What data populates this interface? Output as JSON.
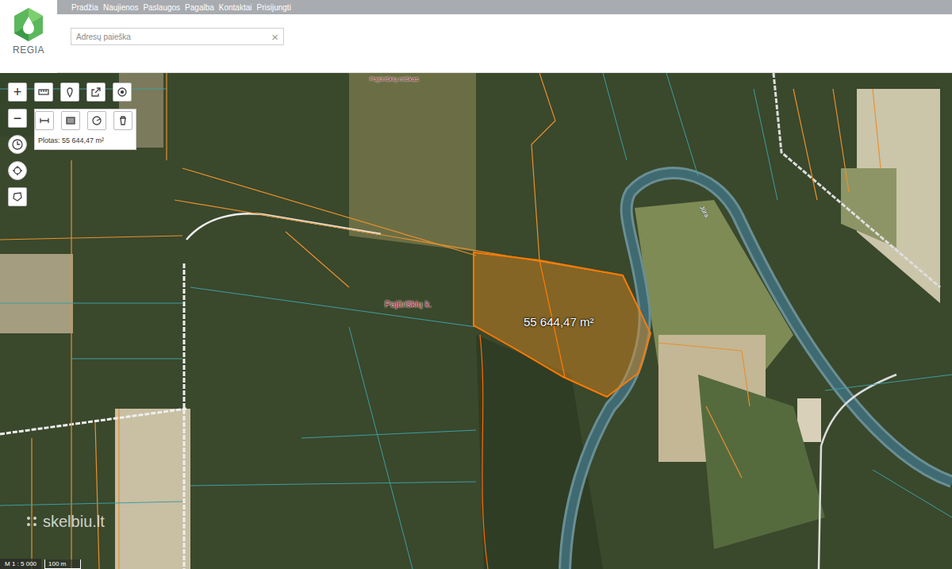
{
  "header": {
    "logo": "REGIA",
    "nav": [
      "Pradžia",
      "Naujienos",
      "Paslaugos",
      "Pagalba",
      "Kontaktai",
      "Prisijungti"
    ],
    "search": {
      "placeholder": "Adresų paieška",
      "clear": "×"
    }
  },
  "map": {
    "tools": {
      "zoom_in": "+",
      "zoom_out": "−"
    },
    "measure": {
      "label": "Plotas: 55 644,47 m²"
    },
    "area_label": "55 644,47 m²",
    "places": [
      {
        "name": "Pajūriškių miškas",
        "kind": "forest"
      },
      {
        "name": "Pajūriškių k.",
        "kind": "village"
      },
      {
        "name": "Jūra",
        "kind": "river"
      }
    ],
    "scale": {
      "ratio": "M 1 : 5 000",
      "bar": "100 m"
    },
    "watermark": "skelbiu.lt"
  }
}
